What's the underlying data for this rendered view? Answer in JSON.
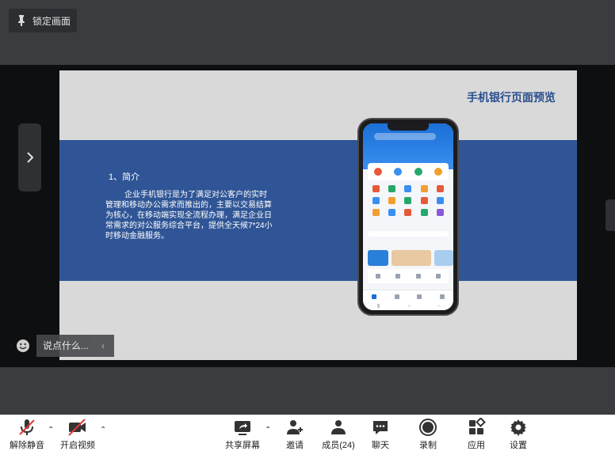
{
  "top": {
    "lock_label": "锁定画面"
  },
  "slide": {
    "title": "手机银行页面预览",
    "section_heading": "1、简介",
    "body": "企业手机银行是为了满足对公客户的实时管理和移动办公需求而推出的，主要以交易结算为核心，在移动端实现全流程办理，满足企业日常需求的对公服务综合平台，提供全天候7*24小时移动金融服务。"
  },
  "chat": {
    "placeholder": "说点什么...",
    "send_symbol": "‹"
  },
  "toolbar": {
    "unmute": "解除静音",
    "video": "开启视频",
    "share": "共享屏幕",
    "invite": "邀请",
    "members": "成员(24)",
    "chat": "聊天",
    "record": "录制",
    "apps": "应用",
    "settings": "设置"
  },
  "icons": [
    "pin-icon",
    "chevron-right-icon",
    "smile-icon",
    "mic-off-icon",
    "camera-off-icon",
    "share-screen-icon",
    "add-person-icon",
    "people-icon",
    "chat-bubble-icon",
    "record-icon",
    "apps-icon",
    "gear-icon"
  ],
  "colors": {
    "slide_band": "#2f5596",
    "slide_title": "#2a4f8d",
    "phone_header": "#1b6fd6"
  }
}
